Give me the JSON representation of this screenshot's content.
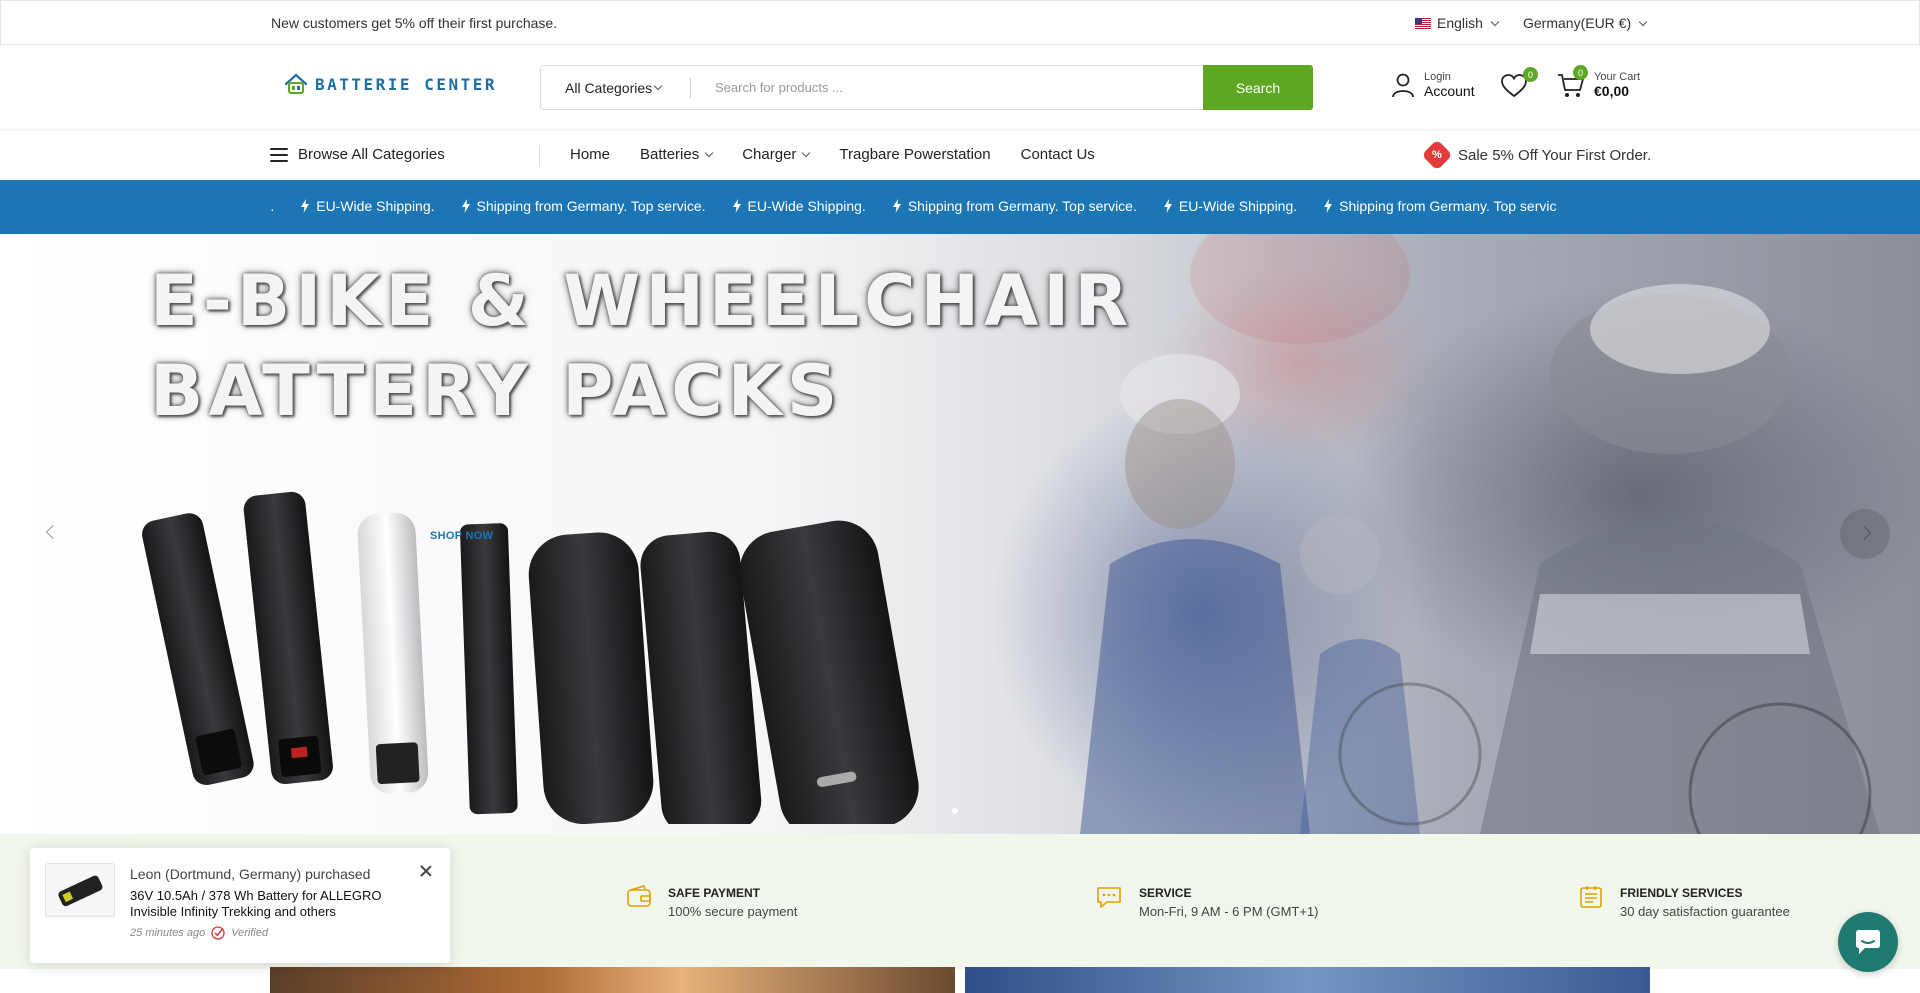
{
  "topbar": {
    "promo": "New customers get 5% off their first purchase.",
    "language": "English",
    "region": "Germany(EUR €)"
  },
  "header": {
    "logo_text": "BATTERIE CENTER",
    "category_select": "All Categories",
    "search_placeholder": "Search for products ...",
    "search_button": "Search",
    "login_label": "Login",
    "account_label": "Account",
    "wishlist_count": "0",
    "cart_count": "0",
    "cart_label": "Your Cart",
    "cart_total": "€0,00"
  },
  "nav": {
    "browse_label": "Browse All Categories",
    "items": [
      {
        "label": "Home",
        "has_dropdown": false
      },
      {
        "label": "Batteries",
        "has_dropdown": true
      },
      {
        "label": "Charger",
        "has_dropdown": true
      },
      {
        "label": "Tragbare Powerstation",
        "has_dropdown": false
      },
      {
        "label": "Contact Us",
        "has_dropdown": false
      }
    ],
    "sale_text": "Sale 5% Off Your First Order.",
    "sale_badge": "%"
  },
  "ticker": {
    "items": [
      "service.",
      "EU-Wide Shipping.",
      "Shipping from Germany. Top service.",
      "EU-Wide Shipping.",
      "Shipping from Germany. Top service.",
      "EU-Wide Shipping.",
      "Shipping from Germany. Top servic"
    ]
  },
  "hero": {
    "title_line1": "E-BIKE & WHEELCHAIR",
    "title_line2": "BATTERY PACKS",
    "cta": "SHOP NOW"
  },
  "features": [
    {
      "icon": "wallet-icon",
      "title": "SAFE PAYMENT",
      "desc": "100% secure payment"
    },
    {
      "icon": "chat-bubble-icon",
      "title": "SERVICE",
      "desc": "Mon-Fri, 9 AM - 6 PM (GMT+1)"
    },
    {
      "icon": "checklist-icon",
      "title": "FRIENDLY SERVICES",
      "desc": "30 day satisfaction guarantee"
    }
  ],
  "popup": {
    "buyer": "Leon (Dortmund, Germany) purchased",
    "product": "36V 10.5Ah / 378 Wh Battery for ALLEGRO Invisible Infinity Trekking and others",
    "time": "25 minutes ago",
    "verified": "Verified"
  },
  "colors": {
    "accent_green": "#5ea723",
    "ticker_blue": "#1c75b5",
    "sale_red": "#e33b3b",
    "chat_teal": "#1f7a72"
  }
}
